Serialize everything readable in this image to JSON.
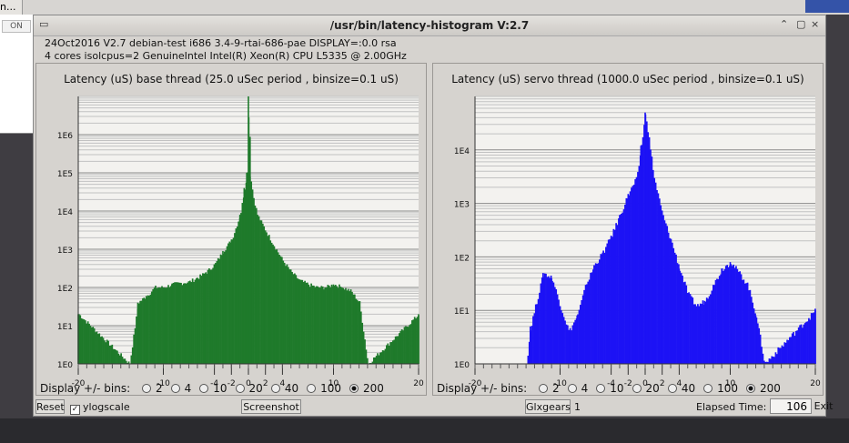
{
  "desktop": {
    "top_tab": "n...",
    "strip_label": "ON"
  },
  "window": {
    "title": "/usr/bin/latency-histogram V:2.7",
    "info_line1": "24Oct2016 V2.7  debian-test  i686  3.4-9-rtai-686-pae  DISPLAY=:0.0  rsa",
    "info_line2": "4 cores  isolcpus=2   GenuineIntel  Intel(R) Xeon(R) CPU L5335 @ 2.00GHz"
  },
  "display_bins": {
    "label": "Display +/- bins:",
    "options": [
      "2",
      "4",
      "10",
      "20",
      "40",
      "100",
      "200"
    ],
    "selected": "200"
  },
  "charts": [
    {
      "title": "Latency (uS) base thread (25.0 uSec period , binsize=0.1 uS)",
      "color": "#1f7a2b",
      "log_labels": [
        "1E0",
        "1E1",
        "1E2",
        "1E3",
        "1E4",
        "1E5",
        "1E6"
      ],
      "x_tick_labels": [
        "-20",
        "-10",
        "-4",
        "-2",
        "0",
        "2",
        "4",
        "10",
        "20"
      ]
    },
    {
      "title": "Latency (uS) servo thread (1000.0 uSec period , binsize=0.1 uS)",
      "color": "#1c12f5",
      "log_labels": [
        "1E0",
        "1E1",
        "1E2",
        "1E3",
        "1E4"
      ],
      "x_tick_labels": [
        "-20",
        "-10",
        "-4",
        "-2",
        "0",
        "2",
        "4",
        "10",
        "20"
      ]
    }
  ],
  "chart_data": [
    {
      "type": "bar",
      "title": "Latency (uS) base thread (25.0 uSec period , binsize=0.1 uS)",
      "xlabel": "",
      "ylabel": "",
      "xlim": [
        -20,
        20
      ],
      "ylog": true,
      "ylim": [
        1,
        10000000
      ],
      "grid": true,
      "x": [
        -20,
        -14,
        -13,
        -12,
        -11,
        -10,
        -9,
        -8,
        -7,
        -6,
        -5,
        -4,
        -3,
        -2,
        -1,
        -0.5,
        -0.2,
        0,
        0.2,
        0.5,
        1,
        2,
        3,
        4,
        5,
        6,
        7,
        8,
        9,
        10,
        11,
        12,
        13,
        14,
        20
      ],
      "values": [
        20,
        1,
        40,
        60,
        100,
        100,
        120,
        130,
        140,
        180,
        250,
        400,
        900,
        1800,
        8000,
        40000,
        100000,
        10000000,
        80000,
        25000,
        8000,
        3000,
        1200,
        500,
        250,
        150,
        120,
        100,
        100,
        120,
        100,
        80,
        40,
        1,
        20
      ]
    },
    {
      "type": "bar",
      "title": "Latency (uS) servo thread (1000.0 uSec period , binsize=0.1 uS)",
      "xlabel": "",
      "ylabel": "",
      "xlim": [
        -20,
        20
      ],
      "ylog": true,
      "ylim": [
        1,
        100000
      ],
      "grid": true,
      "x": [
        -20,
        -14,
        -13.5,
        -12,
        -11,
        -10,
        -9,
        -8,
        -7,
        -6,
        -5,
        -4,
        -3,
        -2,
        -1,
        -0.5,
        0,
        0.5,
        1,
        2,
        3,
        4,
        5,
        6,
        7,
        8,
        9,
        10,
        11,
        12,
        13,
        14,
        20
      ],
      "values": [
        1,
        1,
        5,
        50,
        40,
        12,
        4,
        8,
        30,
        70,
        120,
        250,
        600,
        1500,
        3000,
        12000,
        50000,
        12000,
        3000,
        600,
        200,
        60,
        20,
        12,
        15,
        30,
        60,
        80,
        50,
        30,
        8,
        1,
        10
      ]
    }
  ]
}
